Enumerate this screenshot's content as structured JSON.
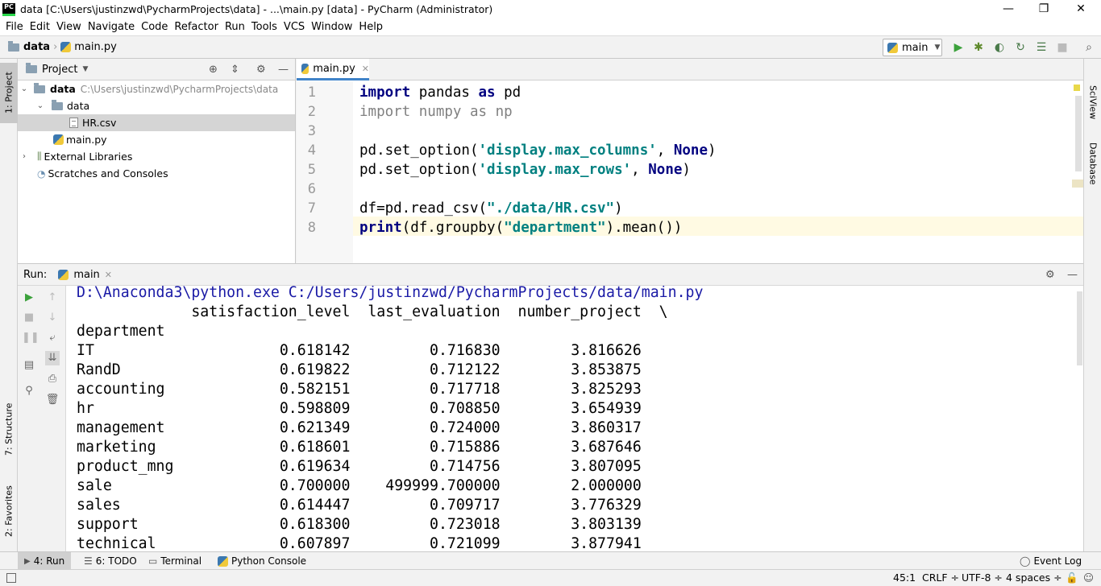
{
  "window": {
    "title": "data [C:\\Users\\justinzwd\\PycharmProjects\\data] - ...\\main.py [data] - PyCharm (Administrator)",
    "logo": "PC",
    "minimize": "—",
    "maximize": "❐",
    "close": "✕"
  },
  "menu": [
    "File",
    "Edit",
    "View",
    "Navigate",
    "Code",
    "Refactor",
    "Run",
    "Tools",
    "VCS",
    "Window",
    "Help"
  ],
  "breadcrumb": {
    "project": "data",
    "file": "main.py"
  },
  "toolbar": {
    "run_config": "main"
  },
  "project_panel": {
    "title": "Project",
    "tree": [
      {
        "label": "data",
        "path": "C:\\Users\\justinzwd\\PycharmProjects\\data"
      },
      {
        "label": "data"
      },
      {
        "label": "HR.csv"
      },
      {
        "label": "main.py"
      },
      {
        "label": "External Libraries"
      },
      {
        "label": "Scratches and Consoles"
      }
    ]
  },
  "editor": {
    "tab": "main.py",
    "line_numbers": [
      "1",
      "2",
      "3",
      "4",
      "5",
      "6",
      "7",
      "8"
    ],
    "lines": [
      [
        {
          "t": "import",
          "c": "kw"
        },
        {
          "t": " pandas ",
          "c": ""
        },
        {
          "t": "as",
          "c": "kw"
        },
        {
          "t": " pd",
          "c": ""
        }
      ],
      [
        {
          "t": "import numpy as np",
          "c": "gray"
        }
      ],
      [],
      [
        {
          "t": "pd.set_option(",
          "c": ""
        },
        {
          "t": "'display.max_columns'",
          "c": "str"
        },
        {
          "t": ", ",
          "c": ""
        },
        {
          "t": "None",
          "c": "kw"
        },
        {
          "t": ")",
          "c": ""
        }
      ],
      [
        {
          "t": "pd.set_option(",
          "c": ""
        },
        {
          "t": "'display.max_rows'",
          "c": "str"
        },
        {
          "t": ", ",
          "c": ""
        },
        {
          "t": "None",
          "c": "kw"
        },
        {
          "t": ")",
          "c": ""
        }
      ],
      [],
      [
        {
          "t": "df=pd.read_csv(",
          "c": ""
        },
        {
          "t": "\"./data/HR.csv\"",
          "c": "str"
        },
        {
          "t": ")",
          "c": ""
        }
      ],
      [
        {
          "t": "print",
          "c": "kw"
        },
        {
          "t": "(df.groupby(",
          "c": ""
        },
        {
          "t": "\"department\"",
          "c": "str"
        },
        {
          "t": ").mean())",
          "c": ""
        }
      ]
    ]
  },
  "run_panel": {
    "label": "Run:",
    "tab": "main",
    "console": [
      "D:\\Anaconda3\\python.exe C:/Users/justinzwd/PycharmProjects/data/main.py",
      "             satisfaction_level  last_evaluation  number_project  \\",
      "department",
      "IT                     0.618142         0.716830        3.816626",
      "RandD                  0.619822         0.712122        3.853875",
      "accounting             0.582151         0.717718        3.825293",
      "hr                     0.598809         0.708850        3.654939",
      "management             0.621349         0.724000        3.860317",
      "marketing              0.618601         0.715886        3.687646",
      "product_mng            0.619634         0.714756        3.807095",
      "sale                   0.700000    499999.700000        2.000000",
      "sales                  0.614447         0.709717        3.776329",
      "support                0.618300         0.723018        3.803139",
      "technical              0.607897         0.721099        3.877941"
    ]
  },
  "left_stripe": {
    "project": "1: Project",
    "structure": "7: Structure",
    "favorites": "2: Favorites"
  },
  "right_stripe": {
    "sciview": "SciView",
    "database": "Database"
  },
  "bottom_tools": {
    "run": "4: Run",
    "todo": "6: TODO",
    "terminal": "Terminal",
    "python_console": "Python Console",
    "event_log": "Event Log"
  },
  "status": {
    "position": "45:1",
    "line_sep": "CRLF ÷",
    "encoding": "UTF-8 ÷",
    "indent": "4 spaces ÷"
  }
}
